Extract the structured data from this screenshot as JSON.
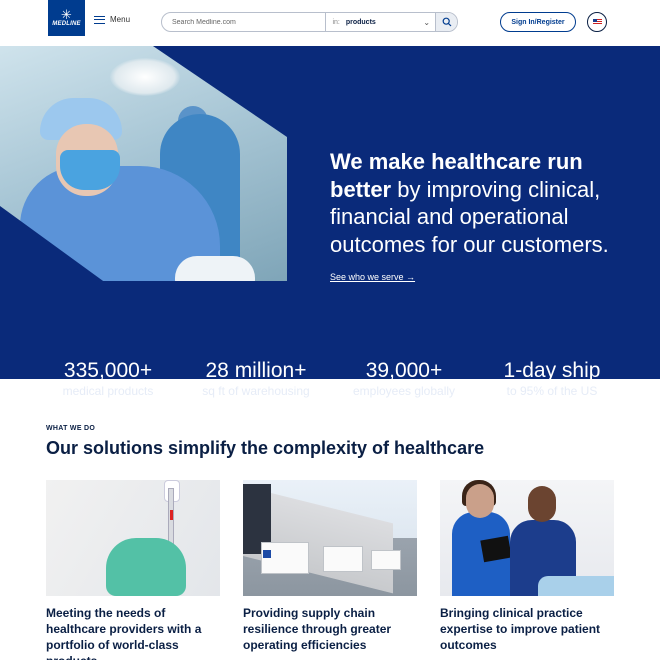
{
  "header": {
    "logo_text": "MEDLINE",
    "menu_label": "Menu",
    "search": {
      "placeholder": "Search Medline.com",
      "scope_prefix": "in:",
      "scope_value": "products"
    },
    "signin_label": "Sign In/Register",
    "locale_flag": "us-flag-icon"
  },
  "hero": {
    "headline_bold": "We make healthcare run better",
    "headline_rest": " by improving clinical, financial and operational outcomes for our customers.",
    "link_label": "See who we serve →",
    "stats": [
      {
        "value": "335,000+",
        "label": "medical products"
      },
      {
        "value": "28 million+",
        "label": "sq ft of warehousing"
      },
      {
        "value": "39,000+",
        "label": "employees globally"
      },
      {
        "value": "1-day ship",
        "label": "to 95% of the US"
      }
    ]
  },
  "what_we_do": {
    "eyebrow": "WHAT WE DO",
    "title": "Our solutions simplify the complexity of healthcare",
    "cards": [
      {
        "title": "Meeting the needs of healthcare providers with a portfolio of world-class products"
      },
      {
        "title": "Providing supply chain resilience through greater operating efficiencies"
      },
      {
        "title": "Bringing clinical practice expertise to improve patient outcomes"
      }
    ]
  },
  "colors": {
    "brand_navy": "#0a2a7a",
    "logo_blue": "#003c8f",
    "text_dark": "#0a1f44"
  }
}
